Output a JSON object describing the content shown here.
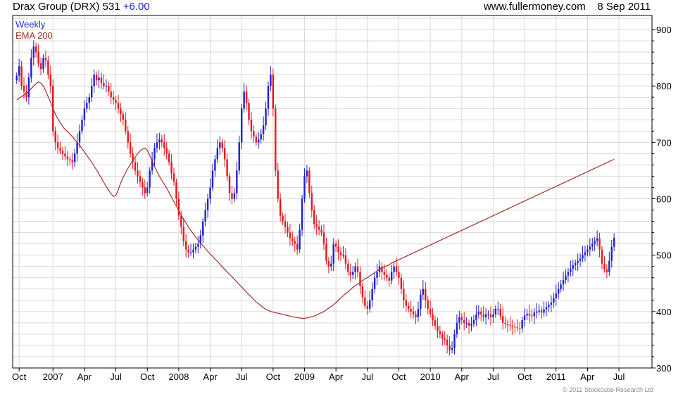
{
  "header": {
    "instrument": "Drax Group (DRX) 531",
    "change": "+6.00",
    "source": "www.fullermoney.com",
    "date": "8 Sep 2011"
  },
  "legend": {
    "period": "Weekly",
    "ema": "EMA 200"
  },
  "credit": "© 2011 Stockcube Research Ltd",
  "colors": {
    "up": "#1f1fd0",
    "down": "#e8141c",
    "ema": "#a0322a",
    "grid": "#d9d9d9",
    "frame": "#000000"
  },
  "chart_data": {
    "type": "candlestick",
    "title": "Drax Group (DRX) 531 +6.00",
    "ylim": [
      300,
      925
    ],
    "yticks": [
      300,
      400,
      500,
      600,
      700,
      800,
      900
    ],
    "y_axis_side": "right",
    "grid": true,
    "x_labels": [
      "Oct",
      "2007",
      "Apr",
      "Jul",
      "Oct",
      "2008",
      "Apr",
      "Jul",
      "Oct",
      "2009",
      "Apr",
      "Jul",
      "Oct",
      "2010",
      "Apr",
      "Jul",
      "Oct",
      "2011",
      "Apr",
      "Jul"
    ],
    "x_label_index": [
      1,
      15,
      28,
      41,
      54,
      67,
      80,
      93,
      106,
      119,
      132,
      145,
      158,
      171,
      184,
      197,
      210,
      223,
      236,
      249
    ],
    "weeks": 262,
    "close": [
      818,
      835,
      800,
      790,
      780,
      815,
      850,
      870,
      860,
      840,
      830,
      850,
      845,
      820,
      800,
      720,
      700,
      690,
      685,
      680,
      675,
      670,
      668,
      665,
      680,
      700,
      720,
      740,
      760,
      770,
      780,
      800,
      820,
      810,
      815,
      805,
      800,
      800,
      790,
      780,
      775,
      770,
      760,
      750,
      740,
      720,
      700,
      680,
      665,
      650,
      640,
      630,
      620,
      610,
      620,
      650,
      670,
      690,
      700,
      705,
      700,
      690,
      680,
      665,
      645,
      630,
      600,
      570,
      550,
      525,
      510,
      505,
      505,
      510,
      515,
      520,
      535,
      560,
      580,
      600,
      620,
      650,
      670,
      690,
      700,
      690,
      670,
      640,
      610,
      600,
      610,
      650,
      700,
      760,
      790,
      770,
      740,
      720,
      710,
      700,
      705,
      715,
      730,
      760,
      800,
      820,
      760,
      650,
      600,
      570,
      560,
      550,
      540,
      530,
      525,
      520,
      510,
      545,
      600,
      640,
      650,
      610,
      580,
      555,
      550,
      545,
      540,
      520,
      490,
      480,
      485,
      520,
      515,
      505,
      500,
      500,
      485,
      470,
      465,
      470,
      480,
      470,
      445,
      425,
      410,
      405,
      420,
      440,
      460,
      470,
      480,
      470,
      465,
      460,
      455,
      470,
      480,
      470,
      460,
      440,
      420,
      410,
      405,
      400,
      395,
      390,
      405,
      430,
      440,
      420,
      405,
      395,
      385,
      375,
      365,
      360,
      352,
      350,
      340,
      332,
      335,
      360,
      380,
      390,
      385,
      380,
      380,
      375,
      378,
      385,
      395,
      400,
      395,
      390,
      395,
      395,
      390,
      395,
      405,
      405,
      392,
      380,
      378,
      376,
      375,
      373,
      372,
      371,
      370,
      385,
      393,
      396,
      393,
      392,
      398,
      400,
      402,
      398,
      404,
      408,
      412,
      416,
      424,
      432,
      440,
      448,
      456,
      464,
      470,
      476,
      482,
      486,
      490,
      494,
      500,
      505,
      510,
      515,
      520,
      525,
      530,
      510,
      485,
      475,
      470,
      490,
      515,
      531
    ],
    "ema_200": [
      775,
      778,
      781,
      784,
      787,
      790,
      795,
      800,
      804,
      807,
      805,
      800,
      791,
      781,
      771,
      760,
      750,
      742,
      735,
      728,
      723,
      719,
      715,
      710,
      705,
      700,
      695,
      689,
      683,
      677,
      671,
      665,
      658,
      651,
      644,
      637,
      629,
      622,
      615,
      609,
      604,
      606,
      616,
      628,
      638,
      646,
      654,
      661,
      668,
      674,
      680,
      685,
      688,
      690,
      686,
      677,
      667,
      657,
      648,
      640,
      633,
      626,
      619,
      611,
      603,
      595,
      587,
      579,
      571,
      564,
      557,
      550,
      544,
      538,
      532,
      527,
      522,
      517,
      512,
      507,
      502,
      498,
      493,
      489,
      484,
      479,
      475,
      470,
      466,
      462,
      457,
      453,
      448,
      444,
      439,
      434,
      430,
      426,
      421,
      417,
      414,
      410,
      407,
      404,
      402,
      400,
      399,
      398,
      397,
      396,
      395,
      394,
      393,
      392,
      391,
      390,
      389,
      389,
      388,
      388,
      389,
      390,
      391,
      392,
      394,
      396,
      398,
      400,
      403,
      406,
      409,
      412,
      416,
      420,
      424,
      428,
      432,
      435,
      439,
      443,
      446,
      449,
      452,
      455,
      458,
      460,
      463,
      466,
      469,
      472,
      475,
      477,
      479,
      481,
      483,
      486,
      488,
      490,
      492,
      494,
      496,
      498,
      500,
      502,
      504,
      506,
      508,
      510,
      512,
      514,
      516,
      518,
      520,
      522,
      524,
      526,
      528,
      530,
      532,
      534,
      536,
      538,
      540,
      542,
      544,
      546,
      548,
      550,
      552,
      554,
      556,
      558,
      560,
      562,
      564,
      566,
      568,
      570,
      572,
      574,
      576,
      578,
      580,
      582,
      584,
      586,
      588,
      590,
      592,
      594,
      596,
      598,
      600,
      602,
      604,
      606,
      608,
      610,
      612,
      614,
      616,
      618,
      620,
      622,
      624,
      626,
      628,
      630,
      632,
      634,
      636,
      638,
      640,
      642,
      644,
      646,
      648,
      650,
      652,
      654,
      656,
      658,
      660,
      662,
      664,
      666,
      668,
      670,
      672,
      674,
      676,
      678,
      680,
      682,
      684,
      686,
      688,
      690,
      692,
      694,
      696
    ]
  }
}
